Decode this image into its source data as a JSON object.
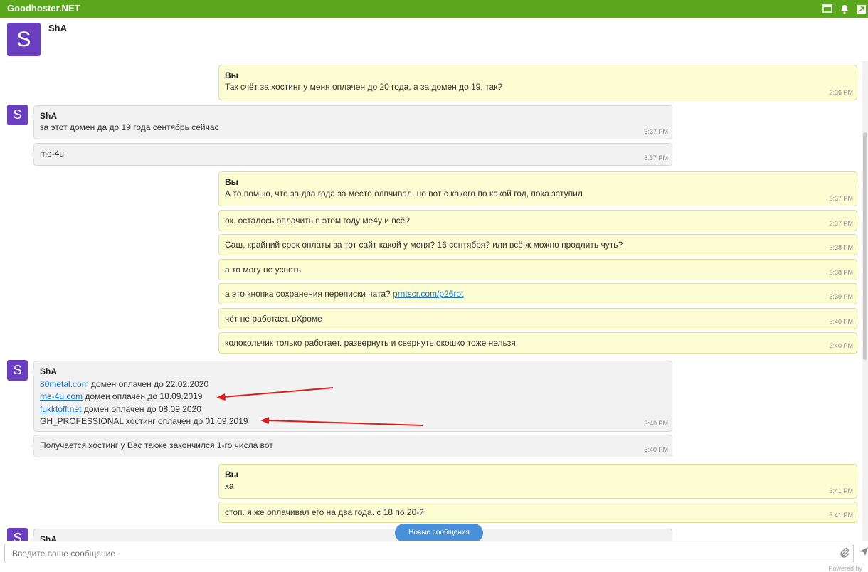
{
  "app": {
    "title": "Goodhoster.NET"
  },
  "colors": {
    "topbar": "#5aa61c",
    "avatar": "#6a3fbf",
    "mine_bubble": "#fdfdd3",
    "their_bubble": "#f2f2f2",
    "link": "#1a73c9",
    "arrow": "#e01b1b"
  },
  "topbar_icons": [
    "window-icon",
    "bell-icon",
    "expand-icon"
  ],
  "header": {
    "avatar_letter": "S",
    "name": "ShA"
  },
  "messages": [
    {
      "author": "Вы",
      "text": "Так счёт за хостинг у меня оплачен до 20 года, а за домен до 19, так?",
      "time": "3:36 PM"
    },
    {
      "author": "ShA",
      "avatar": "S",
      "text": "за этот домен да до 19 года сентябрь сейчас",
      "time": "3:37 PM"
    },
    {
      "text": "me-4u",
      "time": "3:37 PM"
    },
    {
      "author": "Вы",
      "text": "А то помню, что за два года за место олпчивал, но вот с какого по какой год, пока затупил",
      "time": "3:37 PM"
    },
    {
      "text": "ок. осталось оплачить в этом году ме4у и всё?",
      "time": "3:37 PM"
    },
    {
      "text": "Саш, крайний срок оплаты за тот сайт какой у меня? 16 сентября? или всё ж можно продлить чуть?",
      "time": "3:38 PM"
    },
    {
      "text": "а то могу не успеть",
      "time": "3:38 PM"
    },
    {
      "text_before": "а это кнопка сохранения переписки чата?",
      "link": "prntscr.com/p26rot",
      "time": "3:39 PM"
    },
    {
      "text": "чёт не работает. вХроме",
      "time": "3:40 PM"
    },
    {
      "text": "колокольчик только работает. развернуть и свернуть окошко тоже нельзя",
      "time": "3:40 PM"
    },
    {
      "author": "ShA",
      "avatar": "S",
      "lines": [
        {
          "link": "80metal.com",
          "text": " домен оплачен до 22.02.2020"
        },
        {
          "link": "me-4u.com",
          "text": " домен оплачен до 18.09.2019"
        },
        {
          "link": "fukktoff.net",
          "text": " домен оплачен до 08.09.2020"
        },
        {
          "link": "",
          "text": "GH_PROFESSIONAL хостинг оплачен до 01.09.2019"
        }
      ],
      "time": "3:40 PM"
    },
    {
      "text": "Получается хостинг у Вас также закончился 1-го числа вот",
      "time": "3:40 PM"
    },
    {
      "author": "Вы",
      "text": "ха",
      "time": "3:41 PM"
    },
    {
      "text": "стоп. я же оплачивал его на два года. с 18 по 20-й",
      "time": "3:41 PM"
    },
    {
      "author": "ShA",
      "avatar": "S"
    }
  ],
  "new_messages_button": "Новые сообщения",
  "input": {
    "placeholder": "Введите ваше сообщение",
    "value": ""
  },
  "footer": {
    "powered": "Powered by"
  }
}
